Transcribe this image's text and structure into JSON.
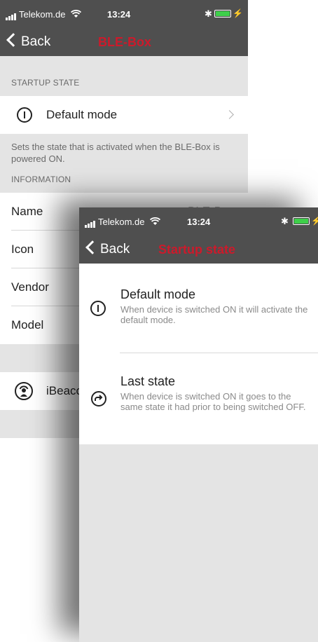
{
  "screen1": {
    "status": {
      "carrier": "Telekom.de",
      "time": "13:24"
    },
    "nav": {
      "back_label": "Back",
      "title": "BLE-Box"
    },
    "startup_section": {
      "header": "STARTUP STATE",
      "row_label": "Default mode",
      "footnote": "Sets the state that is activated when the BLE-Box is powered ON."
    },
    "info_section": {
      "header": "INFORMATION",
      "rows": [
        {
          "label": "Name",
          "value": "BLE-Box"
        },
        {
          "label": "Icon"
        },
        {
          "label": "Vendor"
        },
        {
          "label": "Model"
        }
      ]
    },
    "ibeacon_label": "iBeacon"
  },
  "screen2": {
    "status": {
      "carrier": "Telekom.de",
      "time": "13:24"
    },
    "nav": {
      "back_label": "Back",
      "title": "Startup state"
    },
    "options": [
      {
        "title": "Default mode",
        "desc": "When device is switched ON it will activate the default mode."
      },
      {
        "title": "Last state",
        "desc": "When device is switched ON it goes to the same state it had prior to being switched OFF."
      }
    ]
  },
  "colors": {
    "nav_bg": "#4f4f4f",
    "title_red": "#cc1a2b",
    "section_bg": "#e4e4e4",
    "battery_green": "#3ecf4a"
  },
  "icons": [
    "signal-bars-icon",
    "wifi-icon",
    "bluetooth-icon",
    "battery-icon",
    "chevron-left-icon",
    "power-icon",
    "chevron-right-icon",
    "ibeacon-icon",
    "redo-icon"
  ]
}
